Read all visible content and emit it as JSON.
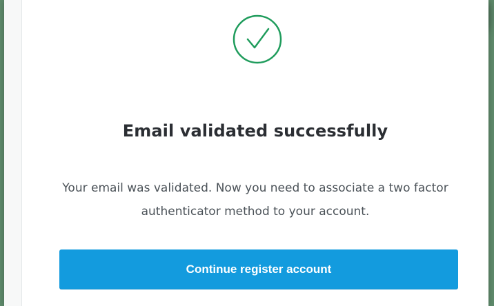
{
  "confirmation": {
    "icon": "check-circle-icon",
    "title": "Email validated successfully",
    "message": "Your email was validated. Now you need to associate a two factor authenticator method to your account.",
    "continue_button_label": "Continue register account"
  },
  "colors": {
    "background_green": "#5f8b6c",
    "success_green": "#1f9c5c",
    "primary_blue": "#139bde",
    "title_text": "#2b2e33",
    "body_text": "#4b5258"
  }
}
